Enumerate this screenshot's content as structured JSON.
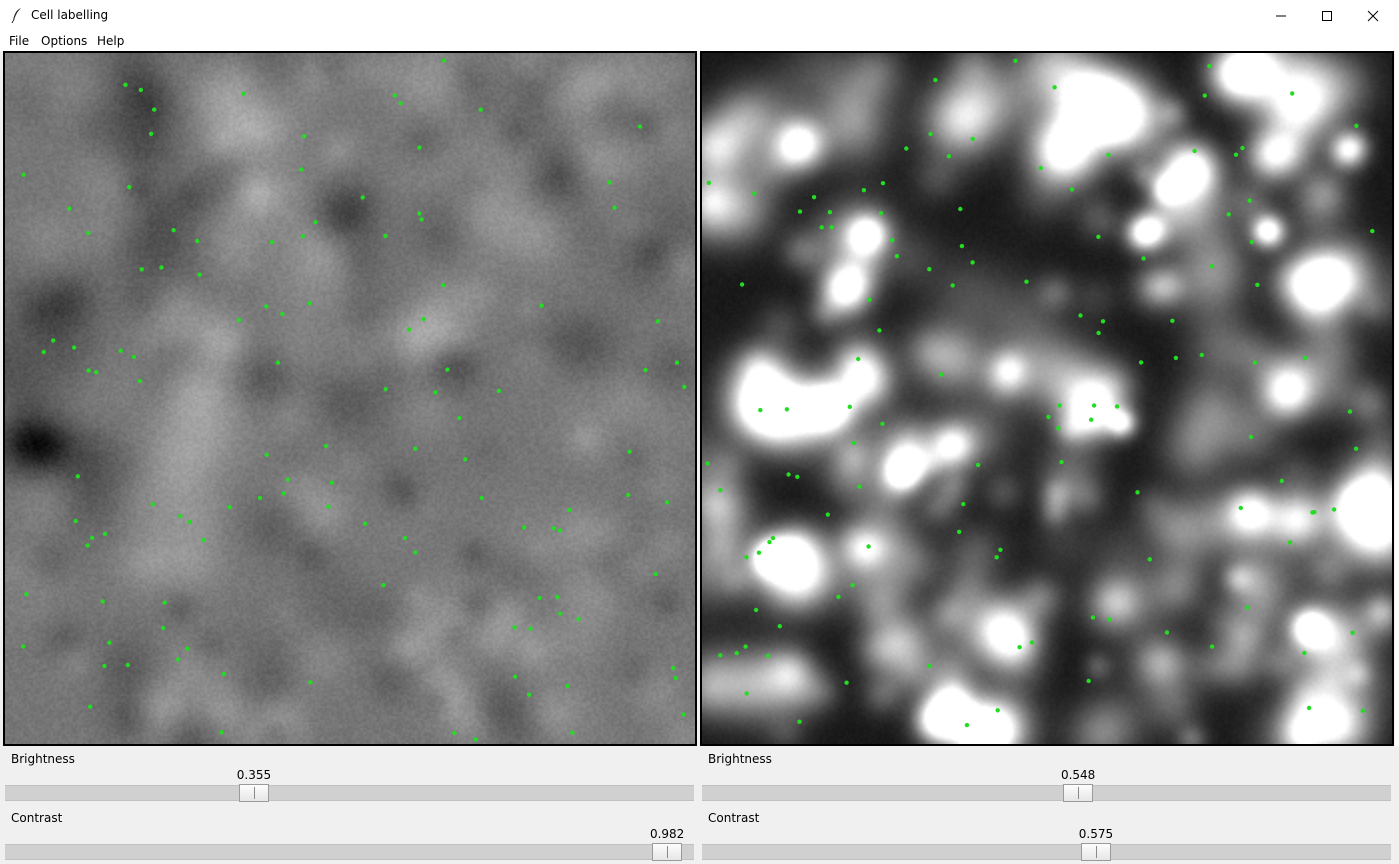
{
  "window": {
    "title": "Cell labelling",
    "icons": {
      "app": "feather-icon",
      "minimize": "minimize-icon",
      "maximize": "maximize-icon",
      "close": "close-icon"
    }
  },
  "menu": {
    "file": "File",
    "options": "Options",
    "help": "Help"
  },
  "colors": {
    "marker": "#22dd22",
    "background": "#f0f0f0",
    "slider_trough": "#d0d0d0"
  },
  "left_panel": {
    "brightness_label": "Brightness",
    "brightness_value": "0.355",
    "brightness_level": 0.355,
    "contrast_label": "Contrast",
    "contrast_value": "0.982",
    "contrast_level": 0.982
  },
  "right_panel": {
    "brightness_label": "Brightness",
    "brightness_value": "0.548",
    "brightness_level": 0.548,
    "contrast_label": "Contrast",
    "contrast_value": "0.575",
    "contrast_level": 0.575
  }
}
